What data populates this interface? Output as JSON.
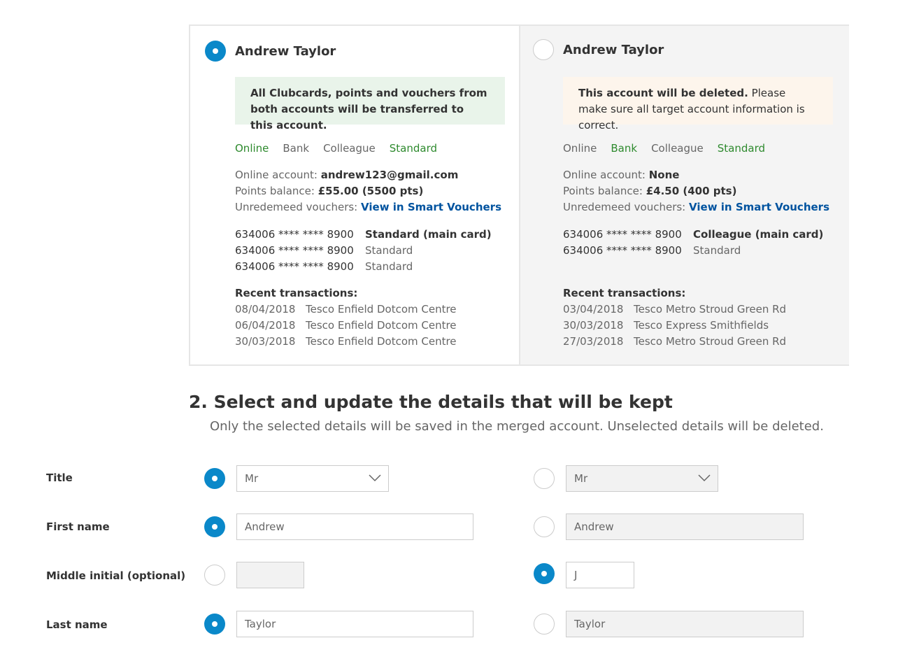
{
  "accounts": [
    {
      "name": "Andrew Taylor",
      "selected": true,
      "notice": {
        "bold": "",
        "text": "All Clubcards, points and vouchers from both accounts will be transferred to this account."
      },
      "tags": [
        {
          "label": "Online",
          "active": true
        },
        {
          "label": "Bank",
          "active": false
        },
        {
          "label": "Colleague",
          "active": false
        },
        {
          "label": "Standard",
          "active": true
        }
      ],
      "online_account_label": "Online account:",
      "online_account_value": "andrew123@gmail.com",
      "points_label": "Points balance:",
      "points_value": "£55.00 (5500 pts)",
      "vouchers_label": "Unredemeed vouchers:",
      "vouchers_link": "View in Smart Vouchers",
      "cards": [
        {
          "number": "634006 **** **** 8900",
          "type": "Standard (main card)",
          "main": true
        },
        {
          "number": "634006 **** **** 8900",
          "type": "Standard",
          "main": false
        },
        {
          "number": "634006 **** **** 8900",
          "type": "Standard",
          "main": false
        }
      ],
      "transactions_label": "Recent transactions:",
      "transactions": [
        {
          "date": "08/04/2018",
          "store": "Tesco Enfield Dotcom Centre"
        },
        {
          "date": "06/04/2018",
          "store": "Tesco Enfield Dotcom Centre"
        },
        {
          "date": "30/03/2018",
          "store": "Tesco Enfield Dotcom Centre"
        }
      ]
    },
    {
      "name": "Andrew Taylor",
      "selected": false,
      "notice": {
        "bold": "This account will be deleted.",
        "text": " Please make sure all target account information is correct."
      },
      "tags": [
        {
          "label": "Online",
          "active": false
        },
        {
          "label": "Bank",
          "active": true
        },
        {
          "label": "Colleague",
          "active": false
        },
        {
          "label": "Standard",
          "active": true
        }
      ],
      "online_account_label": "Online account:",
      "online_account_value": "None",
      "points_label": "Points balance:",
      "points_value": "£4.50 (400 pts)",
      "vouchers_label": "Unredemeed vouchers:",
      "vouchers_link": "View in Smart Vouchers",
      "cards": [
        {
          "number": "634006 **** **** 8900",
          "type": "Colleague (main card)",
          "main": true
        },
        {
          "number": "634006 **** **** 8900",
          "type": "Standard",
          "main": false
        }
      ],
      "transactions_label": "Recent transactions:",
      "transactions": [
        {
          "date": "03/04/2018",
          "store": "Tesco Metro Stroud Green Rd"
        },
        {
          "date": "30/03/2018",
          "store": "Tesco Express Smithfields"
        },
        {
          "date": "27/03/2018",
          "store": "Tesco Metro Stroud Green Rd"
        }
      ]
    }
  ],
  "section2": {
    "heading": "2. Select and update the details that will be kept",
    "subheading": "Only the selected details will be saved in the merged account. Unselected details will be deleted."
  },
  "fields": {
    "title": {
      "label": "Title",
      "left": {
        "value": "Mr",
        "selected": true
      },
      "right": {
        "value": "Mr",
        "selected": false
      }
    },
    "first_name": {
      "label": "First name",
      "left": {
        "value": "Andrew",
        "selected": true
      },
      "right": {
        "value": "Andrew",
        "selected": false
      }
    },
    "middle_initial": {
      "label": "Middle initial (optional)",
      "left": {
        "value": "",
        "selected": false
      },
      "right": {
        "value": "J",
        "selected": true
      }
    },
    "last_name": {
      "label": "Last name",
      "left": {
        "value": "Taylor",
        "selected": true
      },
      "right": {
        "value": "Taylor",
        "selected": false
      }
    }
  },
  "colors": {
    "accent_blue": "#0a88c9",
    "link_blue": "#00539f",
    "tag_green": "#2e8a2e",
    "notice_green_bg": "#e9f4ea",
    "notice_orange_bg": "#fdf5ec"
  }
}
